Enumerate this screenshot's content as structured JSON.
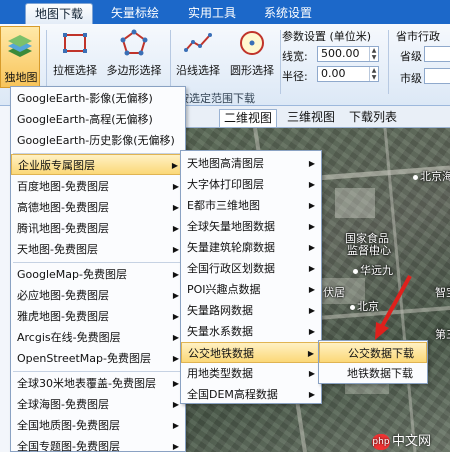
{
  "ribbon_tabs": [
    "地图下载",
    "矢量标绘",
    "实用工具",
    "系统设置"
  ],
  "ribbon": {
    "main_button_label": "独地图",
    "buttons": [
      "拉框选择",
      "多边形选择",
      "沿线选择",
      "圆形选择"
    ],
    "group_label": "按选定范围下载",
    "params_title": "参数设置 (单位米)",
    "line_width_label": "线宽:",
    "line_width_value": "500.00",
    "radius_label": "半径:",
    "radius_value": "0.00",
    "region_title": "省市行政",
    "province_label": "省级",
    "city_label": "市级"
  },
  "map_tabs": [
    "二维视图",
    "三维视图",
    "下载列表"
  ],
  "map_labels": [
    "北京海",
    "国家食品",
    "监督检",
    "中心",
    "华远九",
    "伏居",
    "北京",
    "智宝",
    "第三"
  ],
  "menu1": {
    "items": [
      "GoogleEarth-影像(无偏移)",
      "GoogleEarth-高程(无偏移)",
      "GoogleEarth-历史影像(无偏移)",
      "企业版专属图层",
      "百度地图-免费图层",
      "高德地图-免费图层",
      "腾讯地图-免费图层",
      "天地图-免费图层",
      "GoogleMap-免费图层",
      "必应地图-免费图层",
      "雅虎地图-免费图层",
      "Arcgis在线-免费图层",
      "OpenStreetMap-免费图层",
      "全球30米地表覆盖-免费图层",
      "全球海图-免费图层",
      "全国地质图-免费图层",
      "全国专题图-免费图层"
    ]
  },
  "menu2": {
    "items": [
      "天地图高清图层",
      "大字体打印图层",
      "E都市三维地图",
      "全球矢量地图数据",
      "矢量建筑轮廓数据",
      "全国行政区划数据",
      "POI兴趣点数据",
      "矢量路网数据",
      "矢量水系数据",
      "公交地铁数据",
      "用地类型数据",
      "全国DEM高程数据"
    ]
  },
  "menu3": {
    "items": [
      "公交数据下载",
      "地铁数据下载"
    ]
  },
  "watermark": "中文网",
  "watermark_icon": "php",
  "colors": {
    "tab_bar": "#1c68c9",
    "menu_highlight": "#fbd878",
    "arrow": "#e0201c"
  }
}
